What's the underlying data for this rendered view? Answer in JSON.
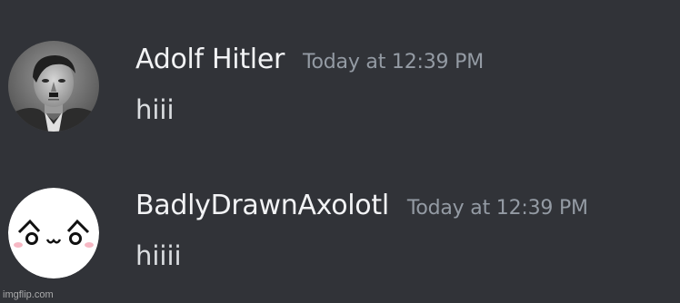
{
  "messages": [
    {
      "username": "Adolf Hitler",
      "timestamp": "Today at 12:39 PM",
      "content": "hiii",
      "avatar_icon": "photo-avatar"
    },
    {
      "username": "BadlyDrawnAxolotl",
      "timestamp": "Today at 12:39 PM",
      "content": "hiiii",
      "avatar_icon": "kawaii-face-avatar"
    }
  ],
  "watermark": "imgflip.com",
  "colors": {
    "background": "#313338",
    "username": "#f2f3f5",
    "timestamp": "#949ba4",
    "message_text": "#dbdee1"
  }
}
